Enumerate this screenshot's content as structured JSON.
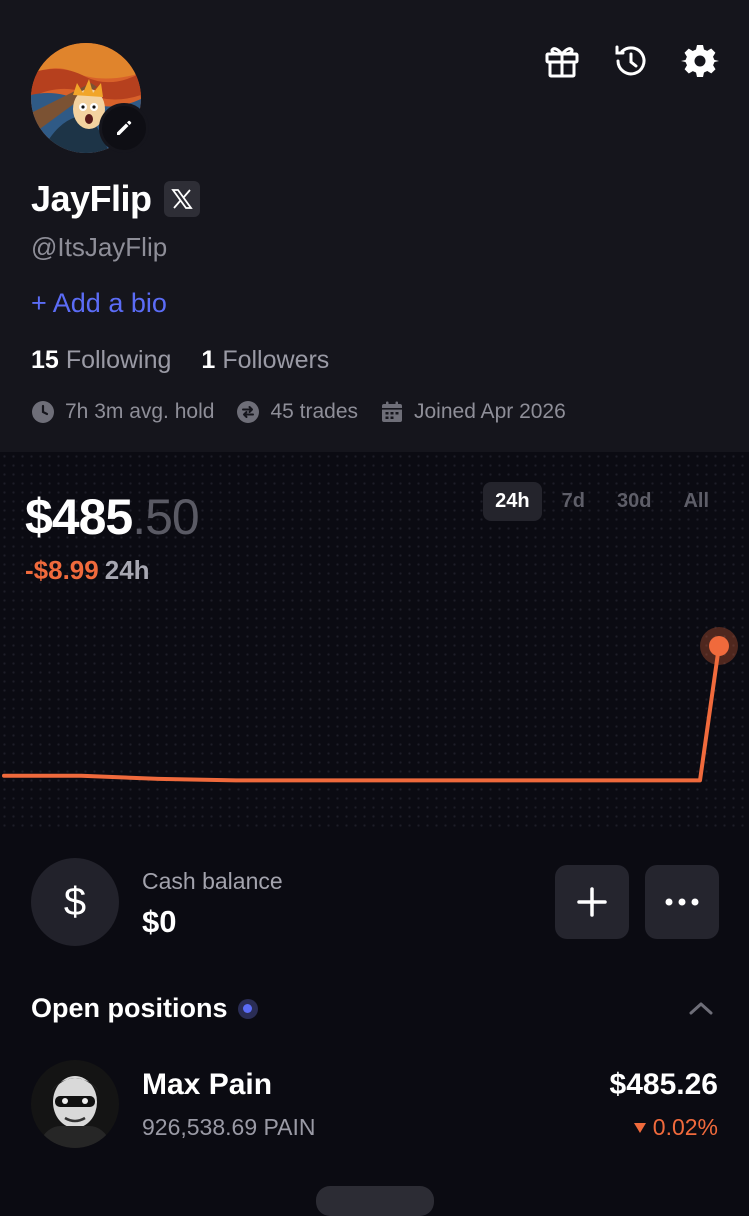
{
  "profile": {
    "name": "JayFlip",
    "handle": "@ItsJayFlip",
    "add_bio": "+ Add a bio",
    "following_count": "15",
    "following_label": "Following",
    "followers_count": "1",
    "followers_label": "Followers",
    "avg_hold": "7h 3m avg. hold",
    "trades": "45 trades",
    "joined": "Joined Apr 2026"
  },
  "portfolio": {
    "balance_whole": "$485",
    "balance_cents": ".50",
    "change_value": "-$8.99",
    "change_period": "24h",
    "ranges": [
      "24h",
      "7d",
      "30d",
      "All"
    ],
    "active_range": "24h"
  },
  "chart_data": {
    "type": "line",
    "x": [
      "0",
      "1",
      "2",
      "3",
      "4",
      "5",
      "6",
      "7",
      "8",
      "9",
      "10"
    ],
    "values": [
      477.2,
      477.2,
      477.0,
      476.9,
      476.9,
      476.9,
      476.9,
      476.9,
      476.9,
      476.9,
      485.5
    ],
    "title": "",
    "xlabel": "",
    "ylabel": "",
    "grid": false,
    "color": "#f06a3c"
  },
  "cash": {
    "label": "Cash balance",
    "value": "$0",
    "icon_glyph": "$"
  },
  "positions": {
    "title": "Open positions",
    "items": [
      {
        "name": "Max Pain",
        "amount": "926,538.69 PAIN",
        "value": "$485.26",
        "change": "0.02%",
        "direction": "down"
      }
    ]
  },
  "colors": {
    "accent_blue": "#5b6cf6",
    "negative": "#f06a3c",
    "profile_bg": "#15151c",
    "page_bg": "#0b0b12"
  }
}
